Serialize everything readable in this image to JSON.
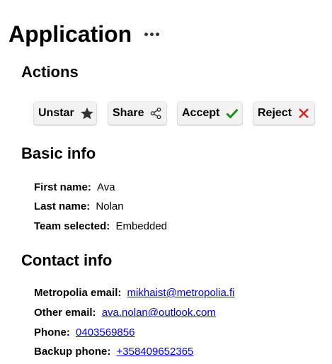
{
  "app": {
    "title": "Application",
    "more_icon": "more-horizontal-icon"
  },
  "actions": {
    "heading": "Actions",
    "buttons": [
      {
        "label": "Unstar",
        "icon": "star-icon",
        "color": "#333333"
      },
      {
        "label": "Share",
        "icon": "share-icon",
        "color": "#333333"
      },
      {
        "label": "Accept",
        "icon": "checkmark-icon",
        "color": "#1a8a1a"
      },
      {
        "label": "Reject",
        "icon": "close-icon",
        "color": "#d91e1e"
      }
    ]
  },
  "basic_info": {
    "heading": "Basic info",
    "fields": [
      {
        "label": "First name:",
        "value": "Ava"
      },
      {
        "label": "Last name:",
        "value": "Nolan"
      },
      {
        "label": "Team selected:",
        "value": "Embedded"
      }
    ]
  },
  "contact_info": {
    "heading": "Contact info",
    "fields": [
      {
        "label": "Metropolia email:",
        "value": "mikhaist@metropolia.fi"
      },
      {
        "label": "Other email:",
        "value": "ava.nolan@outlook.com"
      },
      {
        "label": "Phone:",
        "value": "0403569856"
      },
      {
        "label": "Backup phone:",
        "value": "+358409652365"
      }
    ]
  },
  "colors": {
    "link": "#0000ee",
    "button_bg": "#f2f2f2"
  }
}
